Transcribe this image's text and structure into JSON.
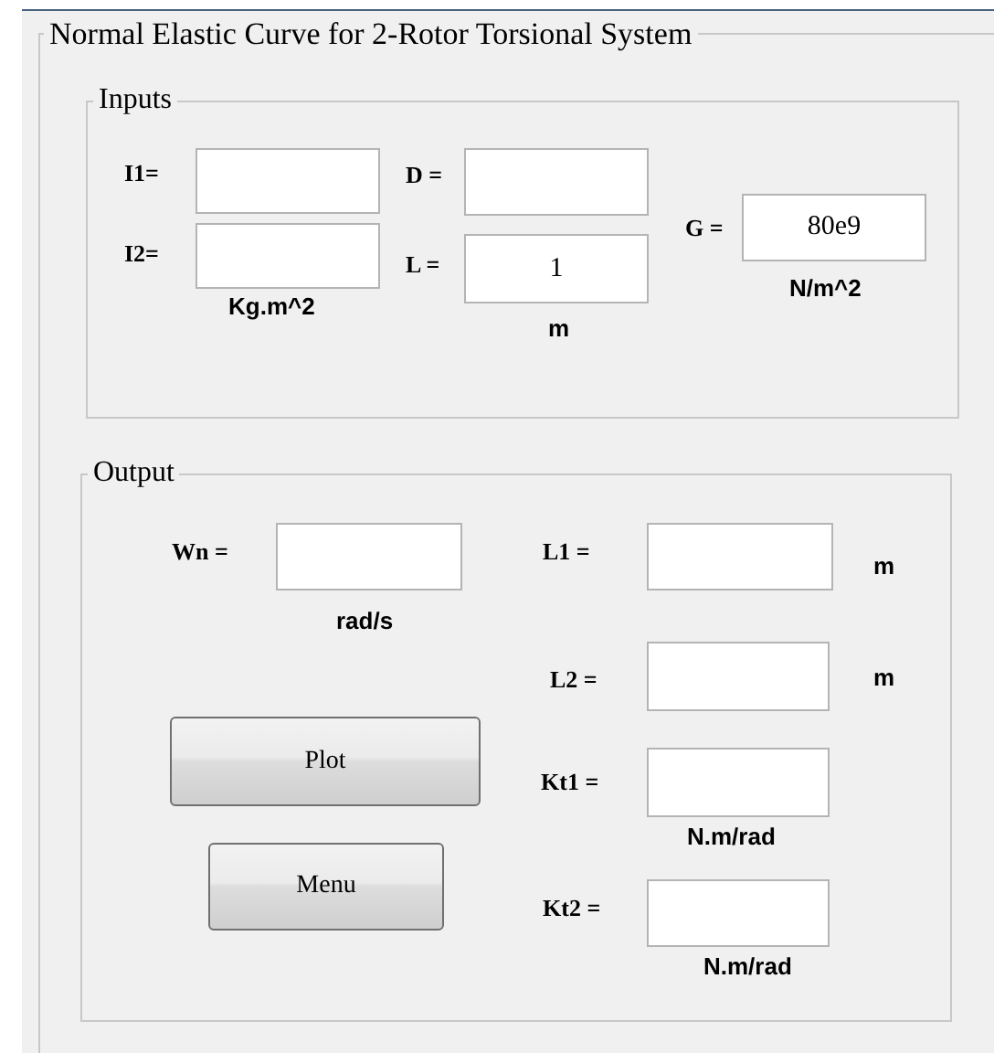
{
  "window": {
    "title": "Normal Elastic Curve for 2-Rotor Torsional System"
  },
  "inputs": {
    "title": "Inputs",
    "fields": [
      {
        "label": "I1="
      },
      {
        "label": "I2="
      },
      {
        "label": "D ="
      },
      {
        "label": "L =",
        "value": "1"
      },
      {
        "label": "G =",
        "value": "80e9"
      }
    ],
    "units": [
      "Kg.m^2",
      "m",
      "N/m^2"
    ]
  },
  "output": {
    "title": "Output",
    "fields": [
      {
        "label": "Wn ="
      },
      {
        "label": "L1 ="
      },
      {
        "label": "L2 ="
      },
      {
        "label": "Kt1 ="
      },
      {
        "label": "Kt2 ="
      }
    ],
    "units": [
      "rad/s",
      "m",
      "m",
      "N.m/rad",
      "N.m/rad"
    ],
    "buttons": [
      "Plot",
      "Menu"
    ]
  }
}
